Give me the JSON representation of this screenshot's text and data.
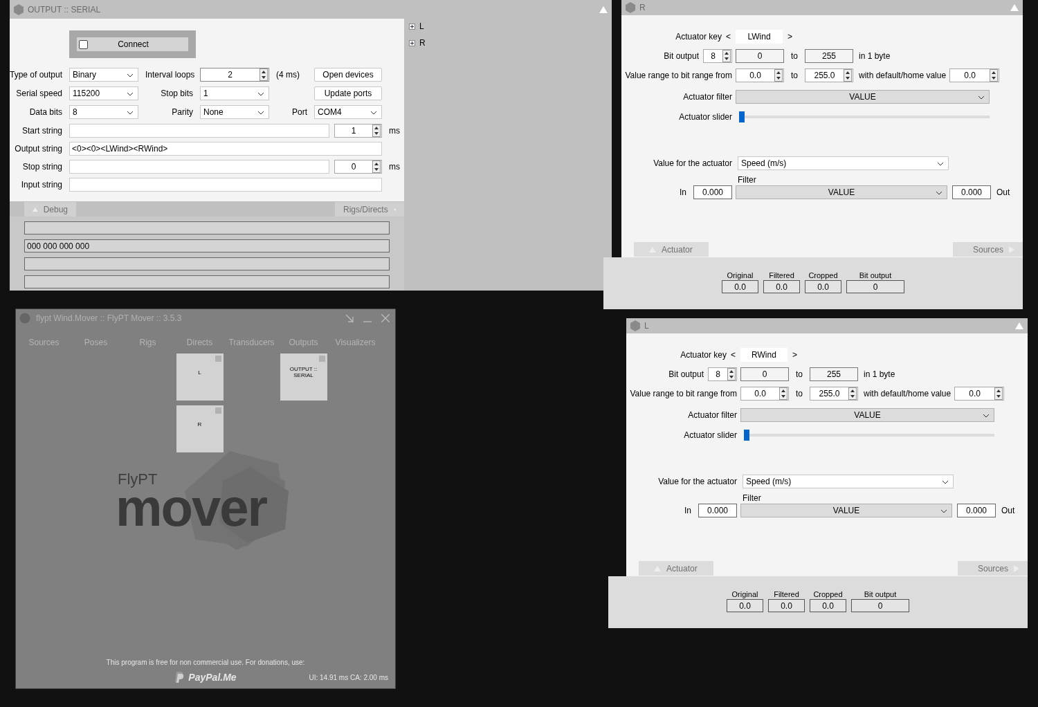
{
  "serial_window": {
    "title": "OUTPUT :: SERIAL",
    "connect": {
      "label": "Connect",
      "checked": false
    },
    "settings": [
      [
        {
          "kind": "select",
          "label": "Type of output",
          "value": "Binary"
        },
        {
          "kind": "spin",
          "label": "Interval loops",
          "value": "2"
        },
        {
          "kind": "note",
          "label": "(4 ms)"
        },
        {
          "kind": "button",
          "label": "Open devices"
        }
      ],
      [
        {
          "kind": "select",
          "label": "Serial speed",
          "value": "115200"
        },
        {
          "kind": "select",
          "label": "Stop bits",
          "value": "1"
        },
        {
          "kind": "button",
          "label": "Update ports"
        }
      ],
      [
        {
          "kind": "select",
          "label": "Data bits",
          "value": "8"
        },
        {
          "kind": "select",
          "label": "Parity",
          "value": "None"
        },
        {
          "kind": "select",
          "label": "Port",
          "value": "COM4"
        }
      ]
    ],
    "strings": [
      {
        "label": "Start string",
        "delay": "1",
        "unit": "ms"
      },
      {
        "label": "Output string",
        "value": "<0><0><LWind><RWind>"
      },
      {
        "label": "Stop string",
        "delay": "0",
        "unit": "ms"
      },
      {
        "label": "Input string"
      }
    ],
    "debug_tab": "Debug",
    "rigs_tab": "Rigs/Directs",
    "debug_value": "000 000 000 000",
    "tree": [
      {
        "label": "L",
        "expanded": false
      },
      {
        "label": "R",
        "expanded": false
      }
    ]
  },
  "main_window": {
    "title": "flypt Wind.Mover :: FlyPT Mover :: 3.5.3",
    "tabs": [
      {
        "label": "Sources"
      },
      {
        "label": "Poses"
      },
      {
        "label": "Rigs"
      },
      {
        "label": "Directs",
        "nodes": [
          {
            "label": "L",
            "checked": false
          },
          {
            "label": "R",
            "checked": false
          }
        ]
      },
      {
        "label": "Transducers"
      },
      {
        "label": "Outputs",
        "nodes": [
          {
            "label": "OUTPUT :: SERIAL",
            "checked": false
          }
        ]
      },
      {
        "label": "Visualizers"
      }
    ],
    "logo": {
      "small": "FlyPT",
      "big": "mover"
    },
    "notice": "This program is free for non commercial use. For donations, use:",
    "paypal": "PayPal.Me",
    "stats": "UI: 14.91 ms  CA: 2.00 ms"
  },
  "actuators": [
    {
      "title": "R",
      "key_label": "Actuator key",
      "key_prev": "<",
      "key": "LWind",
      "key_next": ">",
      "bit_label": "Bit output",
      "bits": "8",
      "bit_min": "0",
      "to_a": "to",
      "bit_max": "255",
      "bytes": "in 1 byte",
      "range_label": "Value range to bit range from",
      "range_from": "0.0",
      "to_b": "to",
      "range_to": "255.0",
      "default_label": "with default/home value",
      "default": "0.0",
      "filter_label": "Actuator filter",
      "filter": "VALUE",
      "slider_label": "Actuator slider",
      "level": 0,
      "value_label": "Value for the actuator",
      "value": "Speed (m/s)",
      "filter2_label": "Filter",
      "in_label": "In",
      "in": "0.000",
      "filter2": "VALUE",
      "out": "0.000",
      "out_label": "Out",
      "tab_left": "Actuator",
      "tab_right": "Sources",
      "readouts": [
        {
          "label": "Original",
          "value": "0.0"
        },
        {
          "label": "Filtered",
          "value": "0.0"
        },
        {
          "label": "Cropped",
          "value": "0.0"
        },
        {
          "label": "Bit output",
          "value": "0"
        }
      ]
    },
    {
      "title": "L",
      "key_label": "Actuator key",
      "key_prev": "<",
      "key": "RWind",
      "key_next": ">",
      "bit_label": "Bit output",
      "bits": "8",
      "bit_min": "0",
      "to_a": "to",
      "bit_max": "255",
      "bytes": "in 1 byte",
      "range_label": "Value range to bit range from",
      "range_from": "0.0",
      "to_b": "to",
      "range_to": "255.0",
      "default_label": "with default/home value",
      "default": "0.0",
      "filter_label": "Actuator filter",
      "filter": "VALUE",
      "slider_label": "Actuator slider",
      "level": 0,
      "value_label": "Value for the actuator",
      "value": "Speed (m/s)",
      "filter2_label": "Filter",
      "in_label": "In",
      "in": "0.000",
      "filter2": "VALUE",
      "out": "0.000",
      "out_label": "Out",
      "tab_left": "Actuator",
      "tab_right": "Sources",
      "readouts": [
        {
          "label": "Original",
          "value": "0.0"
        },
        {
          "label": "Filtered",
          "value": "0.0"
        },
        {
          "label": "Cropped",
          "value": "0.0"
        },
        {
          "label": "Bit output",
          "value": "0"
        }
      ]
    }
  ]
}
